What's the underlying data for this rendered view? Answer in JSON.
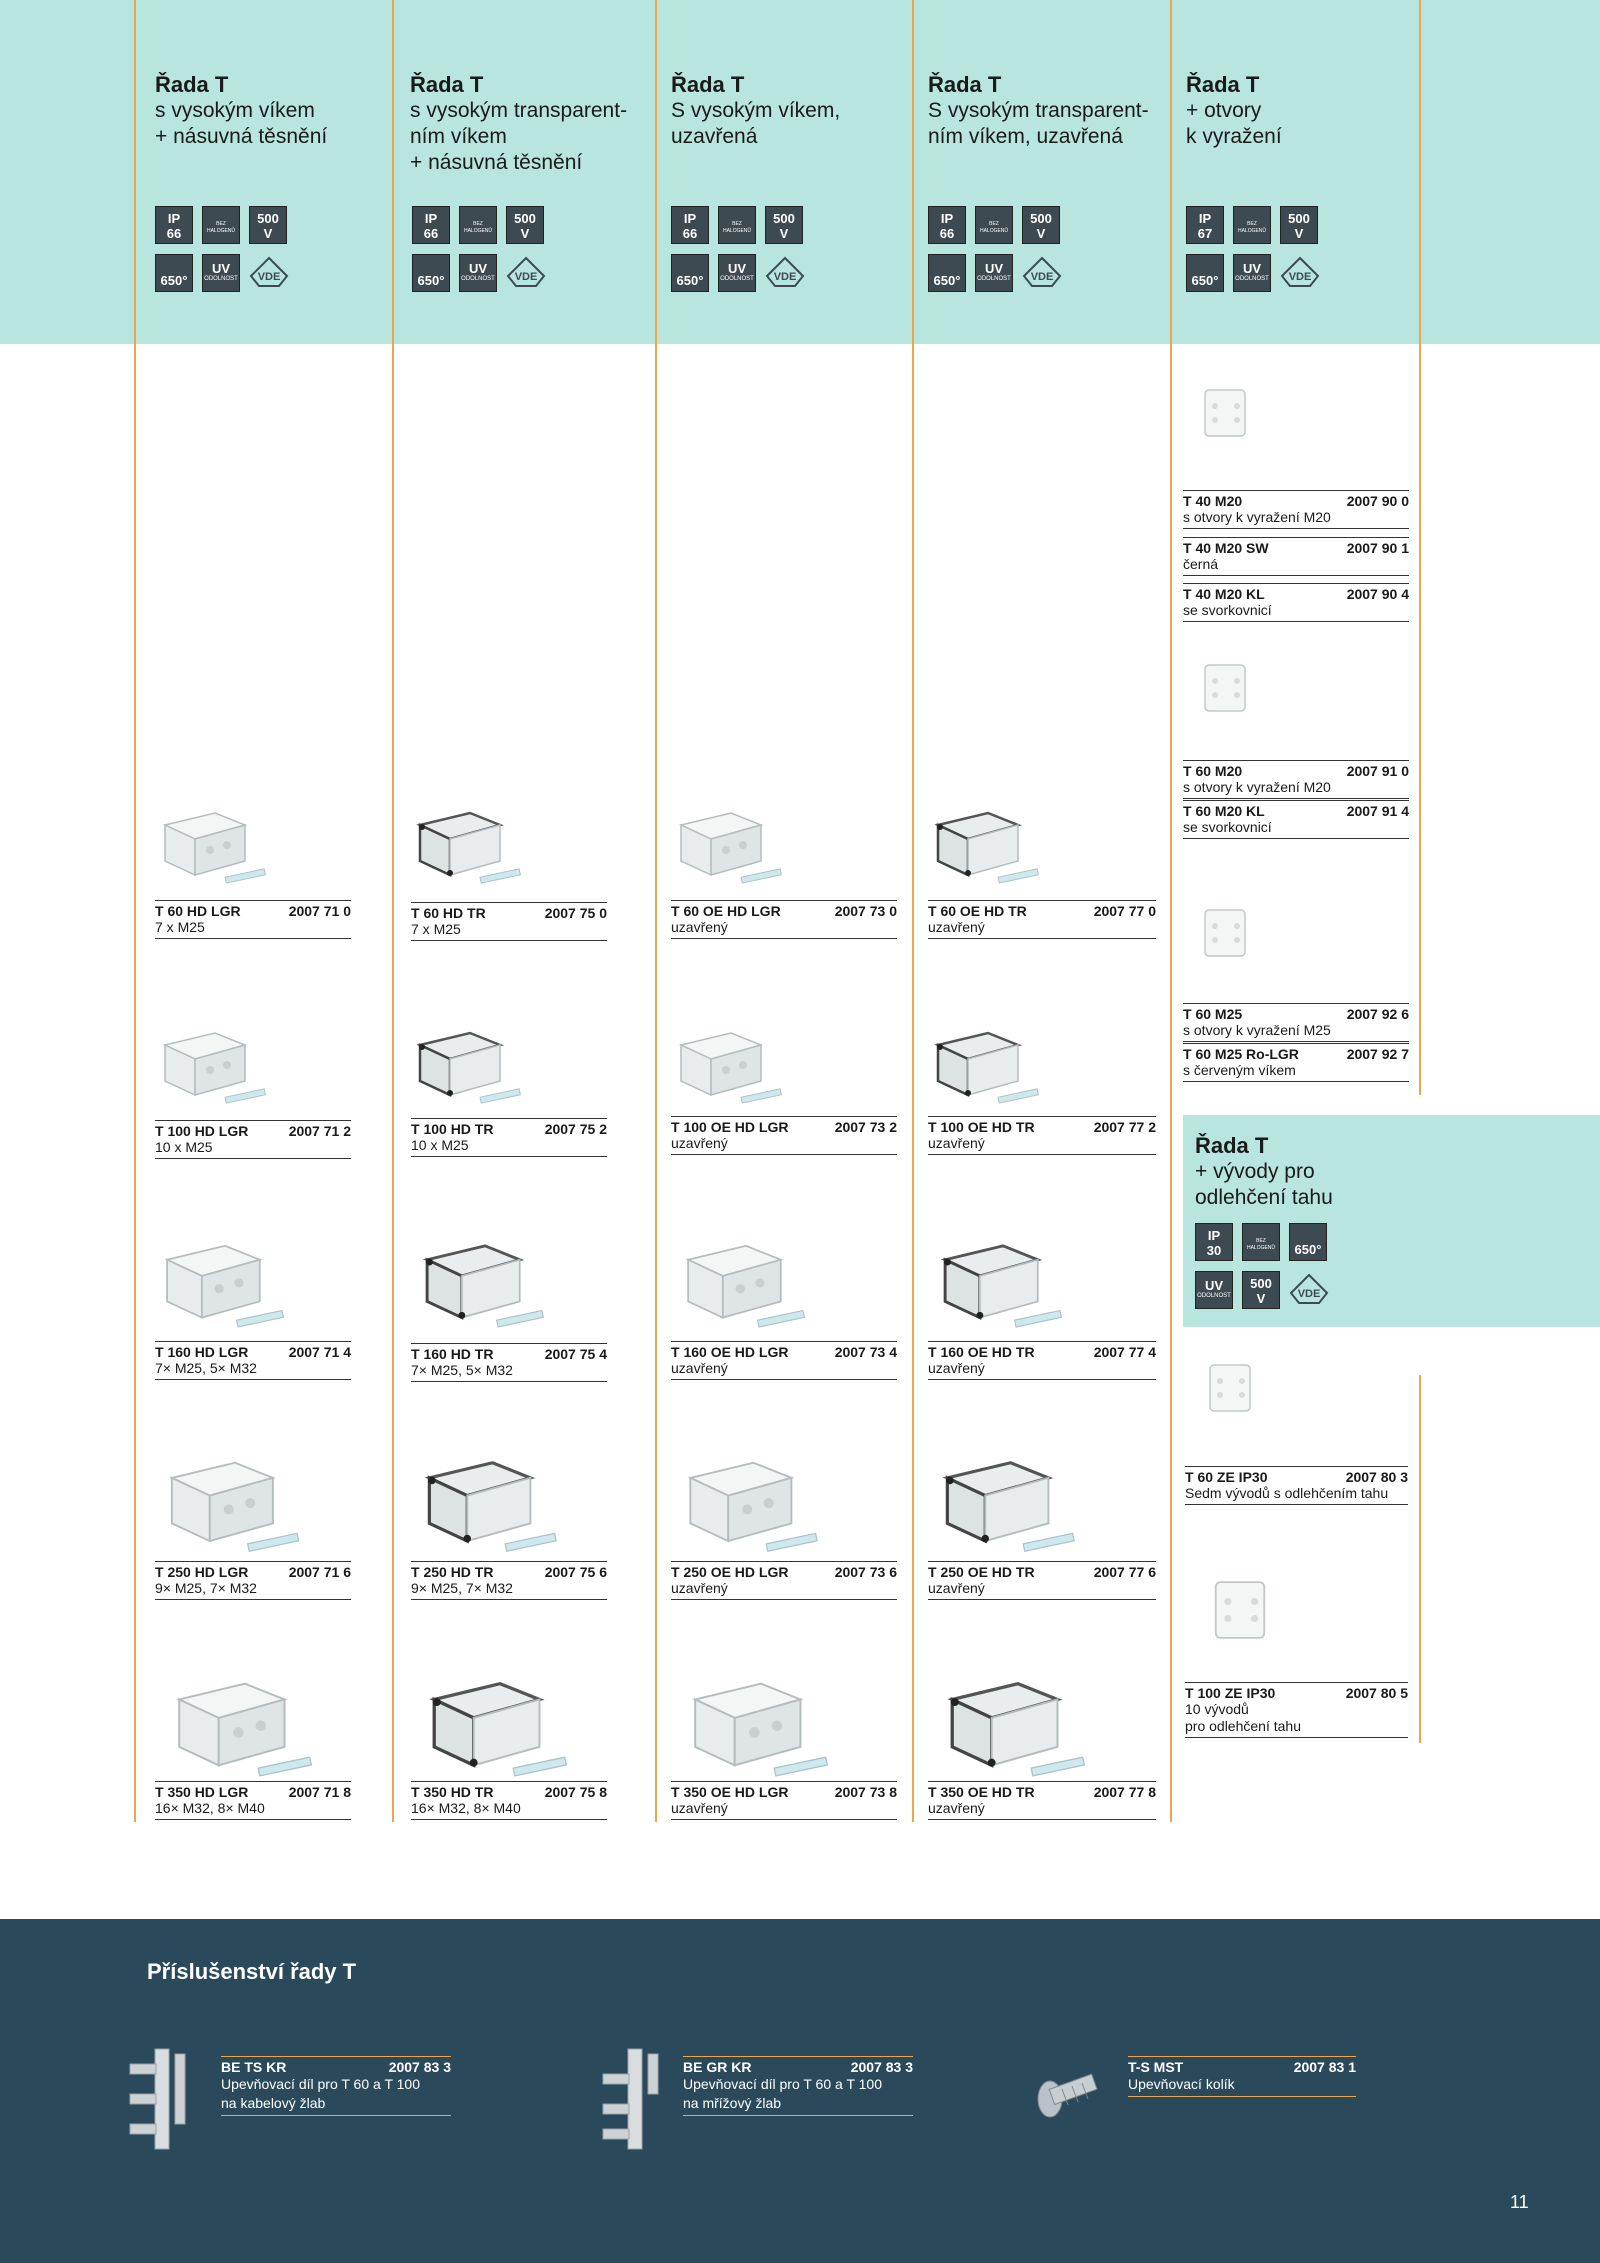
{
  "columns": [
    {
      "title": "Řada T",
      "subtitle": "s vysokým víkem\n+ násuvná těsnění",
      "ip": "IP",
      "ip_val": "66",
      "volt": "500",
      "volt_unit": "V",
      "halo": "BEZ HALOGENŮ",
      "temp": "650",
      "temp_unit": "°",
      "uv": "UV",
      "uv_sub": "ODOLNOST",
      "vde": "VDE"
    },
    {
      "title": "Řada T",
      "subtitle": "s vysokým transparent-\nním víkem\n+ násuvná těsnění",
      "ip": "IP",
      "ip_val": "66",
      "volt": "500",
      "volt_unit": "V",
      "halo": "BEZ HALOGENŮ",
      "temp": "650",
      "temp_unit": "°",
      "uv": "UV",
      "uv_sub": "ODOLNOST",
      "vde": "VDE"
    },
    {
      "title": "Řada T",
      "subtitle": "S vysokým víkem,\nuzavřená",
      "ip": "IP",
      "ip_val": "66",
      "volt": "500",
      "volt_unit": "V",
      "halo": "BEZ HALOGENŮ",
      "temp": "650",
      "temp_unit": "°",
      "uv": "UV",
      "uv_sub": "ODOLNOST",
      "vde": "VDE"
    },
    {
      "title": "Řada T",
      "subtitle": "S vysokým transparent-\nním víkem, uzavřená",
      "ip": "IP",
      "ip_val": "66",
      "volt": "500",
      "volt_unit": "V",
      "halo": "BEZ HALOGENŮ",
      "temp": "650",
      "temp_unit": "°",
      "uv": "UV",
      "uv_sub": "ODOLNOST",
      "vde": "VDE"
    },
    {
      "title": "Řada T",
      "subtitle": "+ otvory\n  k vyražení",
      "ip": "IP",
      "ip_val": "67",
      "volt": "500",
      "volt_unit": "V",
      "halo": "BEZ HALOGENŮ",
      "temp": "650",
      "temp_unit": "°",
      "uv": "UV",
      "uv_sub": "ODOLNOST",
      "vde": "VDE"
    }
  ],
  "products": {
    "c1": [
      {
        "name": "T 60 HD LGR",
        "code": "2007 71 0",
        "desc": "7 x M25"
      },
      {
        "name": "T 100 HD LGR",
        "code": "2007 71 2",
        "desc": "10 x M25"
      },
      {
        "name": "T 160 HD LGR",
        "code": "2007 71 4",
        "desc": "7× M25, 5× M32"
      },
      {
        "name": "T 250 HD LGR",
        "code": "2007 71 6",
        "desc": "9× M25, 7× M32"
      },
      {
        "name": "T 350 HD LGR",
        "code": "2007 71 8",
        "desc": "16× M32, 8× M40"
      }
    ],
    "c2": [
      {
        "name": "T 60 HD TR",
        "code": "2007 75 0",
        "desc": "7 x M25"
      },
      {
        "name": "T 100 HD TR",
        "code": "2007 75 2",
        "desc": "10 x M25"
      },
      {
        "name": "T 160 HD TR",
        "code": "2007 75 4",
        "desc": "7× M25, 5× M32"
      },
      {
        "name": "T 250 HD TR",
        "code": "2007 75 6",
        "desc": "9× M25, 7× M32"
      },
      {
        "name": "T 350 HD TR",
        "code": "2007 75 8",
        "desc": "16× M32, 8× M40"
      }
    ],
    "c3": [
      {
        "name": "T 60 OE HD LGR",
        "code": "2007 73 0",
        "desc": "uzavřený"
      },
      {
        "name": "T 100 OE HD LGR",
        "code": "2007 73 2",
        "desc": "uzavřený"
      },
      {
        "name": "T 160 OE HD LGR",
        "code": "2007 73 4",
        "desc": "uzavřený"
      },
      {
        "name": "T 250 OE HD LGR",
        "code": "2007 73 6",
        "desc": "uzavřený"
      },
      {
        "name": "T 350 OE HD LGR",
        "code": "2007 73 8",
        "desc": "uzavřený"
      }
    ],
    "c4": [
      {
        "name": "T 60 OE HD TR",
        "code": "2007 77 0",
        "desc": "uzavřený"
      },
      {
        "name": "T 100 OE HD TR",
        "code": "2007 77 2",
        "desc": "uzavřený"
      },
      {
        "name": "T 160 OE HD TR",
        "code": "2007 77 4",
        "desc": "uzavřený"
      },
      {
        "name": "T 250 OE HD TR",
        "code": "2007 77 6",
        "desc": "uzavřený"
      },
      {
        "name": "T 350 OE HD TR",
        "code": "2007 77 8",
        "desc": "uzavřený"
      }
    ],
    "c5": [
      {
        "name": "T 40 M20",
        "code": "2007 90 0",
        "desc": "s otvory k vyražení M20"
      },
      {
        "name": "T 40 M20 SW",
        "code": "2007 90 1",
        "desc": "černá"
      },
      {
        "name": "T 40 M20 KL",
        "code": "2007 90 4",
        "desc": "se svorkovnicí"
      },
      {
        "name": "T 60 M20",
        "code": "2007 91 0",
        "desc": "s otvory k vyražení M20"
      },
      {
        "name": "T 60 M20 KL",
        "code": "2007 91 4",
        "desc": "se svorkovnicí"
      },
      {
        "name": "T 60 M25",
        "code": "2007 92 6",
        "desc": "s otvory k vyražení M25"
      },
      {
        "name": "T 60 M25 Ro-LGR",
        "code": "2007 92 7",
        "desc": "s červeným víkem"
      }
    ],
    "c6": [
      {
        "name": "T 60 ZE IP30",
        "code": "2007 80 3",
        "desc": "Sedm vývodů s odlehčením tahu"
      },
      {
        "name": "T 100 ZE IP30",
        "code": "2007 80 5",
        "desc": "10 vývodů\npro odlehčení tahu"
      }
    ]
  },
  "side": {
    "title": "Řada T",
    "subtitle": "+ vývody pro\n  odlehčení tahu",
    "ip": "IP",
    "ip_val": "30",
    "halo": "BEZ HALOGENŮ",
    "temp": "650",
    "temp_unit": "°",
    "uv": "UV",
    "uv_sub": "ODOLNOST",
    "volt": "500",
    "volt_unit": "V",
    "vde": "VDE"
  },
  "footer": {
    "title": "Příslušenství řady T",
    "items": [
      {
        "name": "BE TS KR",
        "code": "2007 83 3",
        "desc": "Upevňovací díl pro T 60 a T 100\nna kabelový žlab"
      },
      {
        "name": "BE GR KR",
        "code": "2007 83 3",
        "desc": "Upevňovací díl pro T 60 a T 100\nna mřížový žlab"
      },
      {
        "name": "T-S MST",
        "code": "2007 83 1",
        "desc": "Upevňovací kolík"
      }
    ],
    "page": "11"
  },
  "colors": {
    "band": "#b8e6de",
    "line": "#f0a44b",
    "footer": "#2a4a5c",
    "badge": "#3d4a52"
  }
}
